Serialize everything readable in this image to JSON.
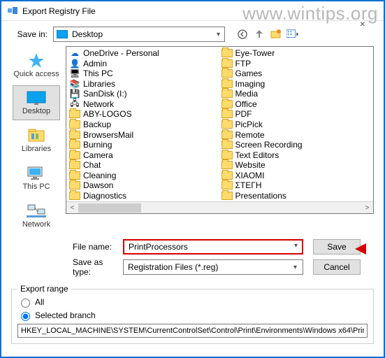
{
  "watermark": "www.wintips.org",
  "window": {
    "title": "Export Registry File"
  },
  "savein": {
    "label": "Save in:",
    "value": "Desktop"
  },
  "places": [
    {
      "label": "Quick access",
      "icon": "star"
    },
    {
      "label": "Desktop",
      "icon": "desktop",
      "selected": true
    },
    {
      "label": "Libraries",
      "icon": "libraries"
    },
    {
      "label": "This PC",
      "icon": "pc"
    },
    {
      "label": "Network",
      "icon": "network"
    }
  ],
  "listing": {
    "col1": [
      {
        "name": "OneDrive - Personal",
        "icon": "onedrive"
      },
      {
        "name": "Admin",
        "icon": "user"
      },
      {
        "name": "This PC",
        "icon": "pc"
      },
      {
        "name": "Libraries",
        "icon": "lib"
      },
      {
        "name": "SanDisk (I:)",
        "icon": "disk"
      },
      {
        "name": "Network",
        "icon": "net"
      },
      {
        "name": "ABY-LOGOS",
        "icon": "folder"
      },
      {
        "name": "Backup",
        "icon": "folder"
      },
      {
        "name": "BrowsersMail",
        "icon": "folder"
      },
      {
        "name": "Burning",
        "icon": "folder"
      },
      {
        "name": "Camera",
        "icon": "folder"
      },
      {
        "name": "Chat",
        "icon": "folder"
      },
      {
        "name": "Cleaning",
        "icon": "folder"
      },
      {
        "name": "Dawson",
        "icon": "folder"
      },
      {
        "name": "Diagnostics",
        "icon": "folder"
      }
    ],
    "col2": [
      {
        "name": "Eye-Tower",
        "icon": "folder"
      },
      {
        "name": "FTP",
        "icon": "folder"
      },
      {
        "name": "Games",
        "icon": "folder"
      },
      {
        "name": "Imaging",
        "icon": "folder"
      },
      {
        "name": "Media",
        "icon": "folder"
      },
      {
        "name": "Office",
        "icon": "folder"
      },
      {
        "name": "PDF",
        "icon": "folder"
      },
      {
        "name": "PicPick",
        "icon": "folder"
      },
      {
        "name": "Remote",
        "icon": "folder"
      },
      {
        "name": "Screen Recording",
        "icon": "folder"
      },
      {
        "name": "Text Editors",
        "icon": "folder"
      },
      {
        "name": "Website",
        "icon": "folder"
      },
      {
        "name": "XIAOMI",
        "icon": "folder"
      },
      {
        "name": "ΣΤΕΓΗ",
        "icon": "folder"
      },
      {
        "name": "Presentations",
        "icon": "folder"
      }
    ]
  },
  "filename": {
    "label": "File name:",
    "value": "PrintProcessors"
  },
  "saveas": {
    "label": "Save as type:",
    "value": "Registration Files (*.reg)"
  },
  "buttons": {
    "save": "Save",
    "cancel": "Cancel"
  },
  "exportrange": {
    "legend": "Export range",
    "all": "All",
    "selected": "Selected branch",
    "branch": "HKEY_LOCAL_MACHINE\\SYSTEM\\CurrentControlSet\\Control\\Print\\Environments\\Windows x64\\Prin"
  }
}
